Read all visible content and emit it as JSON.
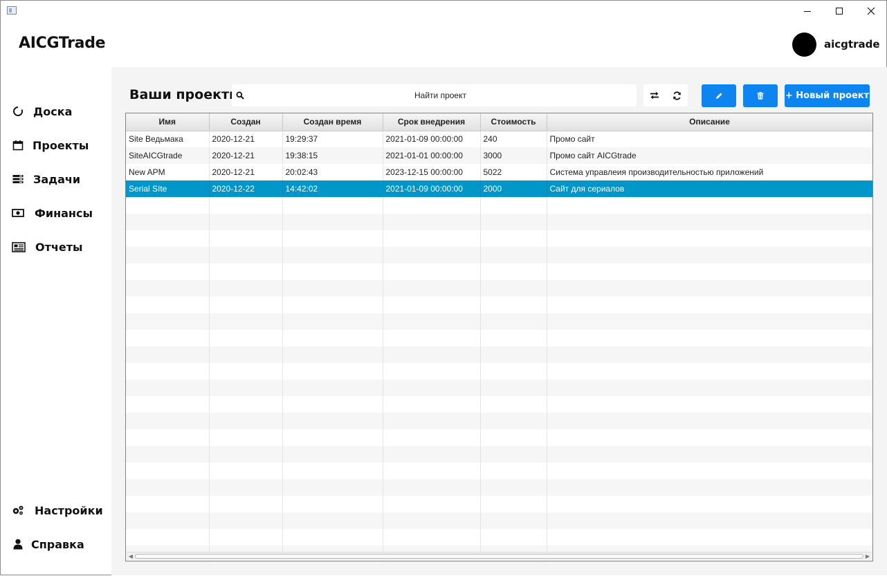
{
  "app": {
    "title": "AICGTrade",
    "username": "aicgtrade"
  },
  "sidebar": {
    "items": [
      {
        "label": "Доска",
        "icon": "circle-refresh-icon"
      },
      {
        "label": "Проекты",
        "icon": "calendar-icon"
      },
      {
        "label": "Задачи",
        "icon": "tasks-icon"
      },
      {
        "label": "Финансы",
        "icon": "money-icon"
      },
      {
        "label": "Отчеты",
        "icon": "newspaper-icon"
      }
    ],
    "bottom_items": [
      {
        "label": "Настройки",
        "icon": "gears-icon"
      },
      {
        "label": "Справка",
        "icon": "user-icon"
      }
    ]
  },
  "main": {
    "title": "Ваши проекты",
    "search_placeholder": "Найти проект",
    "new_project_label": "+ Новый проект"
  },
  "table": {
    "columns": [
      "Имя",
      "Создан",
      "Создан время",
      "Срок внедрения",
      "Стоимость",
      "Описание"
    ],
    "rows": [
      [
        "Site Ведьмака",
        "2020-12-21",
        "19:29:37",
        "2021-01-09 00:00:00",
        "240",
        "Промо сайт"
      ],
      [
        "SiteAICGtrade",
        "2020-12-21",
        "19:38:15",
        "2021-01-01 00:00:00",
        "3000",
        "Промо сайт AICGtrade"
      ],
      [
        "New APM",
        "2020-12-21",
        "20:02:43",
        "2023-12-15 00:00:00",
        "5022",
        "Система управлеия производительностью приложений"
      ],
      [
        "Serial SIte",
        "2020-12-22",
        "14:42:02",
        "2021-01-09 00:00:00",
        "2000",
        "Сайт для сериалов"
      ]
    ],
    "selected_row": 3
  },
  "colors": {
    "accent": "#0d84f0",
    "selection": "#0096c9",
    "table_border": "#1aa3e0"
  }
}
